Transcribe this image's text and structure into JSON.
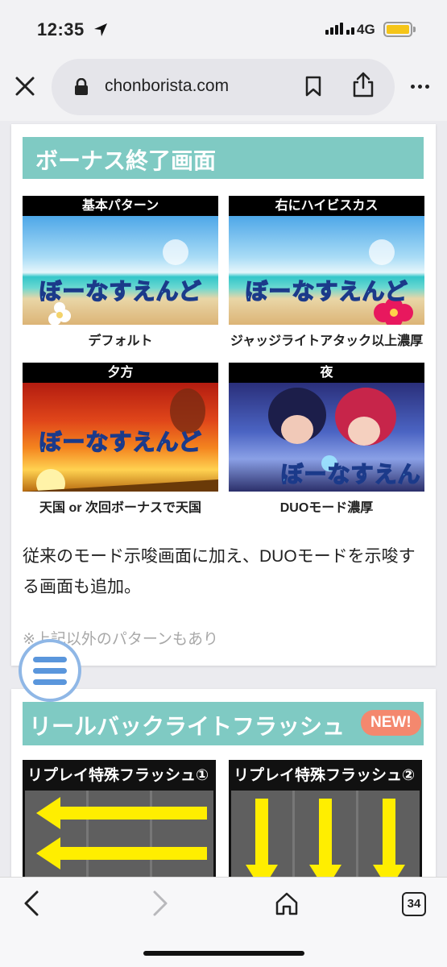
{
  "status": {
    "time": "12:35",
    "network": "4G",
    "battery_level": 1.0
  },
  "browser": {
    "url": "chonborista.com",
    "tab_count": "34"
  },
  "section1": {
    "title": "ボーナス終了画面",
    "tiles": [
      {
        "caption": "基本パターン",
        "logo": "ぼーなすえんど",
        "label": "デフォルト"
      },
      {
        "caption": "右にハイビスカス",
        "logo": "ぼーなすえんど",
        "label": "ジャッジライトアタック以上濃厚"
      },
      {
        "caption": "夕方",
        "logo": "ぼーなすえんど",
        "label": "天国 or 次回ボーナスで天国"
      },
      {
        "caption": "夜",
        "logo": "ぼーなすえんど",
        "label": "DUOモード濃厚"
      }
    ],
    "paragraph": "従来のモード示唆画面に加え、DUOモードを示唆する画面も追加。",
    "note": "※上記以外のパターンもあり"
  },
  "section2": {
    "title": "リールバックライトフラッシュ",
    "badge": "NEW!",
    "panels": [
      {
        "caption": "リプレイ特殊フラッシュ①"
      },
      {
        "caption": "リプレイ特殊フラッシュ②"
      }
    ]
  },
  "colors": {
    "accent": "#7fcac3",
    "badge": "#f4886e",
    "arrow": "#ffee00",
    "menu": "#5a96dc"
  }
}
